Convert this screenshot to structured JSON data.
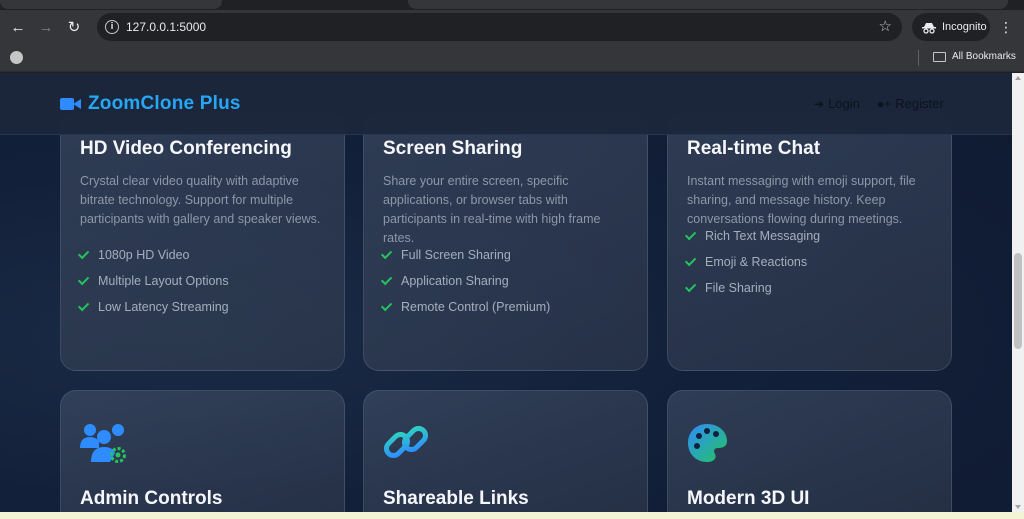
{
  "browser": {
    "url": "127.0.0.1:5000",
    "incognito_label": "Incognito",
    "bookmarks_label": "All Bookmarks"
  },
  "site": {
    "brand": "ZoomClone Plus",
    "nav": {
      "login": "Login",
      "register": "Register"
    }
  },
  "features_top": [
    {
      "title": "HD Video Conferencing",
      "description": "Crystal clear video quality with adaptive bitrate technology. Support for multiple participants with gallery and speaker views.",
      "items": [
        "1080p HD Video",
        "Multiple Layout Options",
        "Low Latency Streaming"
      ]
    },
    {
      "title": "Screen Sharing",
      "description": "Share your entire screen, specific applications, or browser tabs with participants in real-time with high frame rates.",
      "items": [
        "Full Screen Sharing",
        "Application Sharing",
        "Remote Control (Premium)"
      ]
    },
    {
      "title": "Real-time Chat",
      "description": "Instant messaging with emoji support, file sharing, and message history. Keep conversations flowing during meetings.",
      "items": [
        "Rich Text Messaging",
        "Emoji & Reactions",
        "File Sharing"
      ]
    }
  ],
  "features_bottom": [
    {
      "title": "Admin Controls",
      "icon": "users-cog-icon"
    },
    {
      "title": "Shareable Links",
      "icon": "link-icon"
    },
    {
      "title": "Modern 3D UI",
      "icon": "palette-icon"
    }
  ],
  "colors": {
    "brand": "#27a6f5",
    "check": "#22c55e",
    "icon_accent": "#2f8cff"
  }
}
